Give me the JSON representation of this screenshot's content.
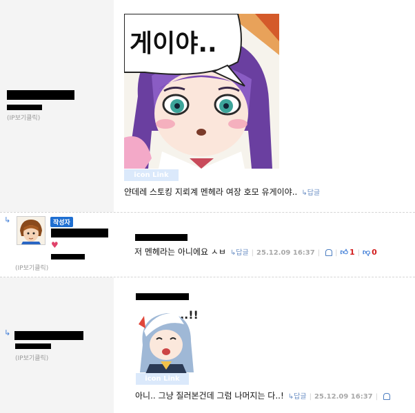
{
  "comments": [
    {
      "ip_label": "(IP보기클릭)",
      "image_caption": "게이야..",
      "icon_link": "icon Link",
      "text": "얀데레 스토킹 지뢰계 멘헤라 여장 호모 유게이야..",
      "reply_label": "↳답글"
    },
    {
      "author_badge": "작성자",
      "ip_label": "(IP보기클릭)",
      "text": "저 멘헤라는 아니에요 ㅅㅂ",
      "reply_label": "↳답글",
      "date": "25.12.09 16:37",
      "upvotes": "1",
      "downvotes": "0"
    },
    {
      "ip_label": "(IP보기클릭)",
      "image_caption": "...!!",
      "icon_link": "icon Link",
      "text": "아니.. 그냥 질러본건데 그럼 나머지는 다..!",
      "reply_label": "↳답글",
      "date": "25.12.09 16:37"
    }
  ],
  "colors": {
    "accent": "#1f6fd1",
    "upvote": "#d21e1e",
    "downvote": "#d21e1e",
    "link": "#6b8fc4"
  }
}
